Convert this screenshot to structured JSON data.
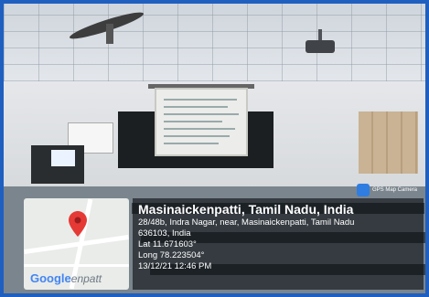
{
  "overlay": {
    "app_badge": "GPS Map Camera",
    "title": "Masinaickenpatti, Tamil Nadu, India",
    "address_line1": "28/48b, Indra Nagar, near, Masinaickenpatti, Tamil Nadu",
    "address_line2": "636103, India",
    "lat": "Lat 11.671603°",
    "long": "Long 78.223504°",
    "datetime": "13/12/21 12:46 PM"
  },
  "map": {
    "google_label": "Google",
    "google_suffix": "enpatt",
    "pin_color": "#e53935"
  },
  "colors": {
    "frame": "#1f5fbf"
  }
}
